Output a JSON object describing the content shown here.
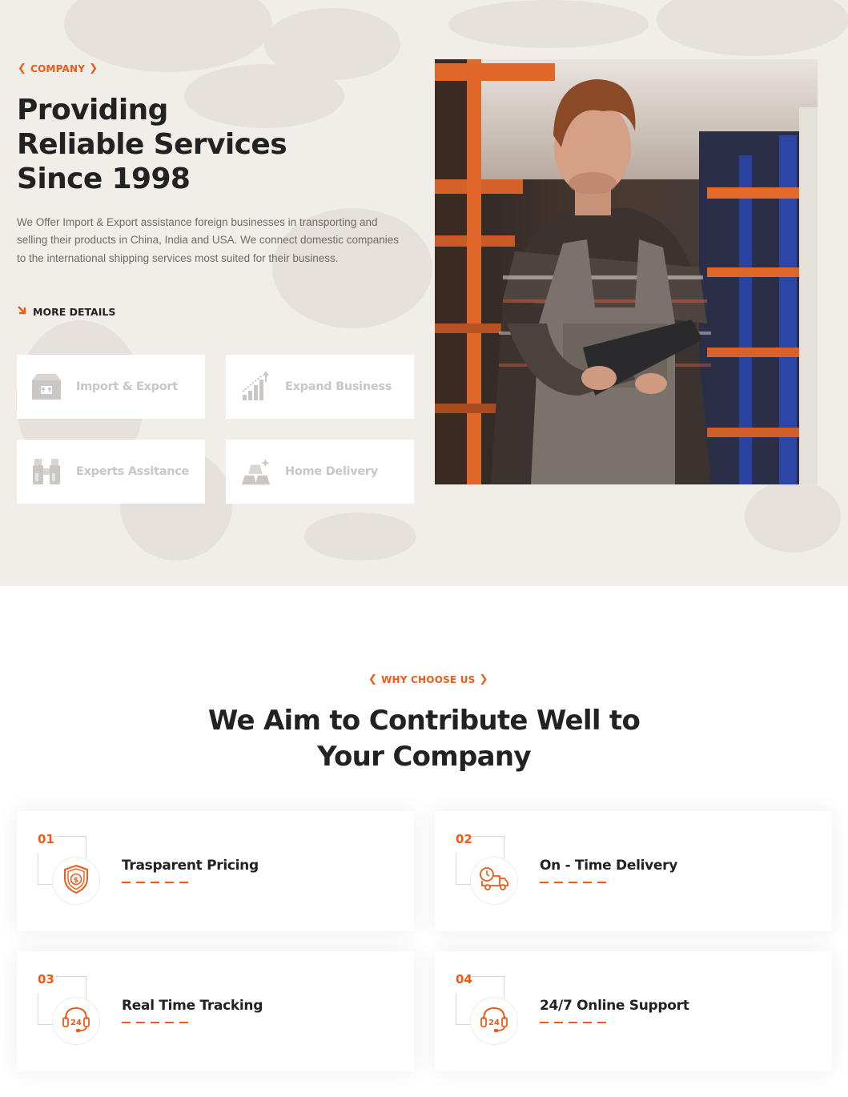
{
  "company": {
    "eyebrow": "COMPANY",
    "title_lines": [
      "Providing",
      "Reliable Services",
      "Since 1998"
    ],
    "description": "We Offer Import & Export assistance foreign businesses in transporting and selling their products in China, India and USA. We connect domestic companies to the international shipping services most suited for their business.",
    "more_details": "MORE DETAILS",
    "services": [
      {
        "label": "Import & Export",
        "icon": "box-icon"
      },
      {
        "label": "Expand Business",
        "icon": "growth-chart-icon"
      },
      {
        "label": "Experts Assitance",
        "icon": "binoculars-icon"
      },
      {
        "label": "Home Delivery",
        "icon": "gold-bars-icon"
      }
    ],
    "photo": "warehouse-worker-with-clipboard"
  },
  "why": {
    "eyebrow": "WHY CHOOSE US",
    "title_lines": [
      "We Aim to Contribute Well to",
      "Your Company"
    ],
    "features": [
      {
        "num": "01",
        "title": "Trasparent Pricing",
        "icon": "shield-dollar-icon"
      },
      {
        "num": "02",
        "title": "On - Time Delivery",
        "icon": "delivery-truck-icon"
      },
      {
        "num": "03",
        "title": "Real Time Tracking",
        "icon": "headset-24-icon"
      },
      {
        "num": "04",
        "title": "24/7 Online Support",
        "icon": "headset-24-icon"
      }
    ]
  },
  "colors": {
    "accent": "#f05a16",
    "section_bg": "#f1ede8",
    "heading": "#222222",
    "muted_text": "#6f6a66",
    "service_label": "#c9c6c3"
  }
}
